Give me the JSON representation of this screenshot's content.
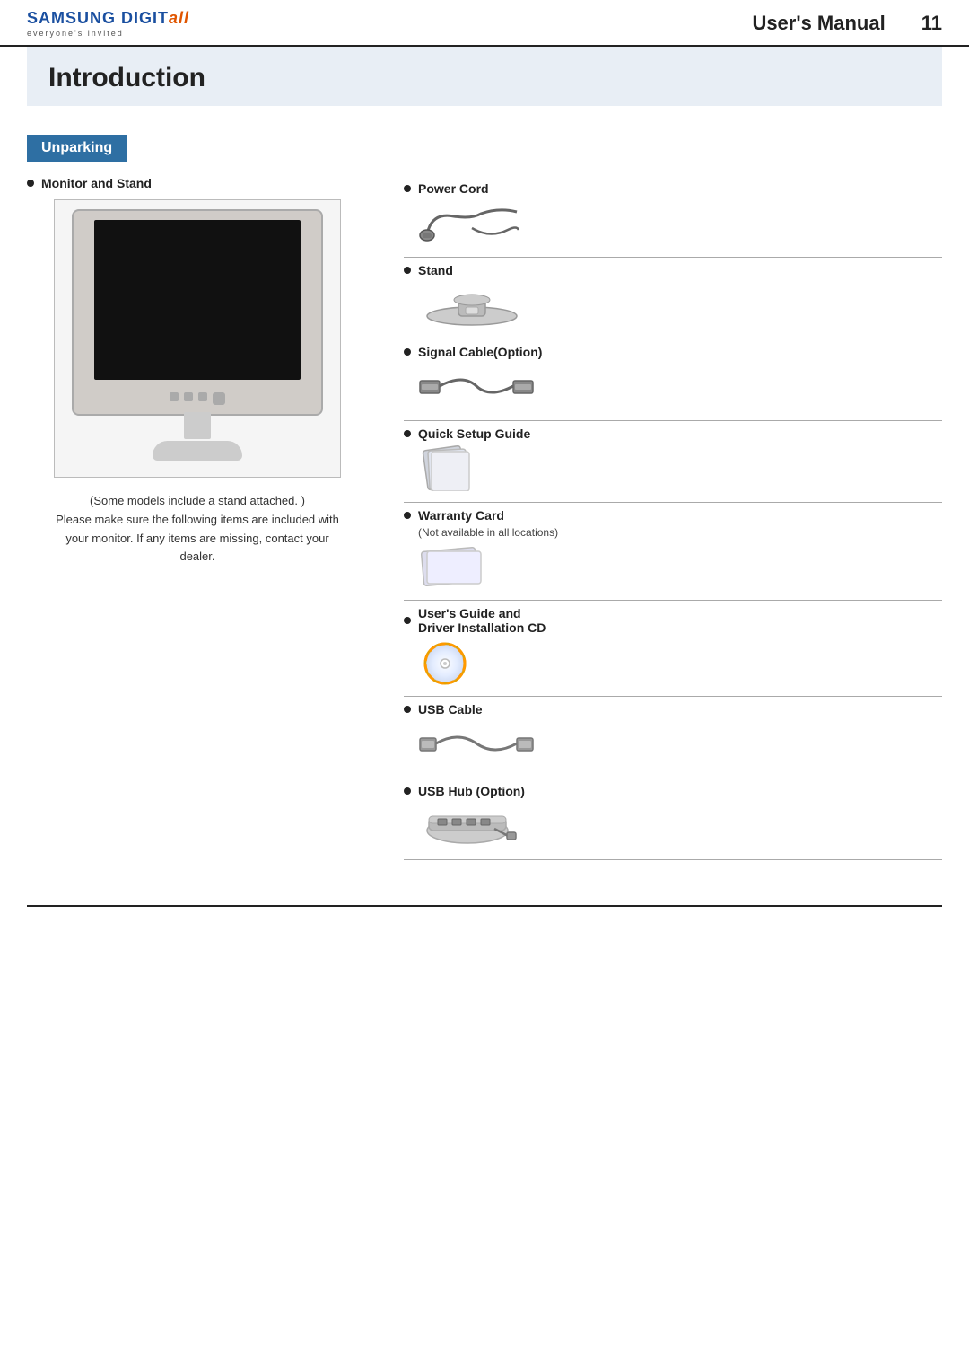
{
  "header": {
    "brand_samsung": "SAMSUNG DIGIT",
    "brand_all": "all",
    "brand_tagline": "everyone's invited",
    "manual_title": "User's Manual",
    "page_number": "11"
  },
  "intro": {
    "title": "Introduction"
  },
  "unparking": {
    "heading": "Unparking",
    "monitor_label": "Monitor and Stand",
    "caption_line1": "(Some models include a stand attached. )",
    "caption_line2": "Please make sure the following items are included with",
    "caption_line3": "your monitor. If any items are missing, contact your",
    "caption_line4": "dealer."
  },
  "items": [
    {
      "label": "Power Cord",
      "sublabel": null,
      "icon_type": "power_cord"
    },
    {
      "label": "Stand",
      "sublabel": null,
      "icon_type": "stand"
    },
    {
      "label": "Signal Cable(Option)",
      "sublabel": null,
      "icon_type": "cable"
    },
    {
      "label": "Quick Setup Guide",
      "sublabel": null,
      "icon_type": "booklet"
    },
    {
      "label": "Warranty Card",
      "sublabel": "(Not available in all locations)",
      "icon_type": "card"
    },
    {
      "label": "User's Guide and",
      "label2": "Driver Installation CD",
      "sublabel": null,
      "icon_type": "cd"
    },
    {
      "label": "USB Cable",
      "sublabel": null,
      "icon_type": "usb_cable"
    },
    {
      "label": "USB Hub (Option)",
      "sublabel": null,
      "icon_type": "usb_hub"
    }
  ]
}
